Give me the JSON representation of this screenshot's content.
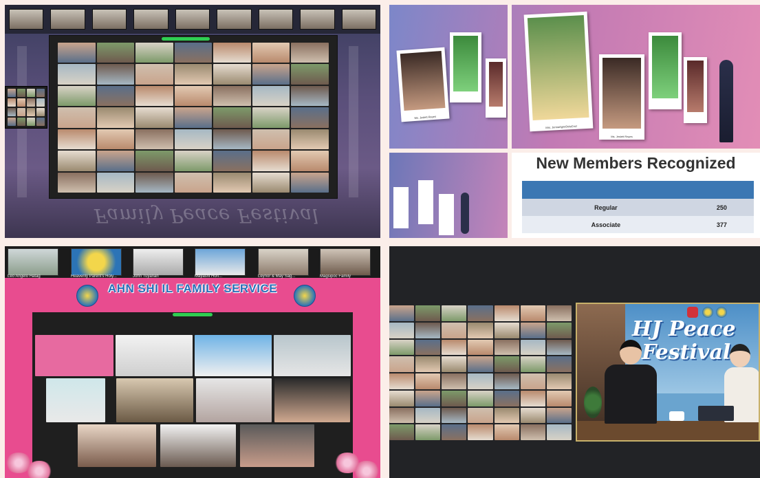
{
  "panel_top_left": {
    "floor_text": "Family Peace Festival"
  },
  "panel_top_right": {
    "photo_captions": [
      "Ms. Jeslett Reyes",
      "Mrs. JennaAgneDelaCruz",
      "Ms. Jeslett Reyes"
    ],
    "table_title": "New Members Recognized",
    "rows": [
      {
        "label": "Regular",
        "value": "250"
      },
      {
        "label": "Associate",
        "value": "377"
      }
    ]
  },
  "panel_bottom_left": {
    "banner": "AHN SHI IL FAMILY SERVICE",
    "video_labels": [
      "Leo Angelo Hatag",
      "Heavenly Parent's Holy...",
      "John Tuyanan",
      "Mayashi Hon...",
      "Leynor & May Sag...",
      "Magsipoc Family"
    ]
  },
  "panel_bottom_right": {
    "stage_title_line1": "HJ Peace",
    "stage_title_line2": "Festival"
  }
}
